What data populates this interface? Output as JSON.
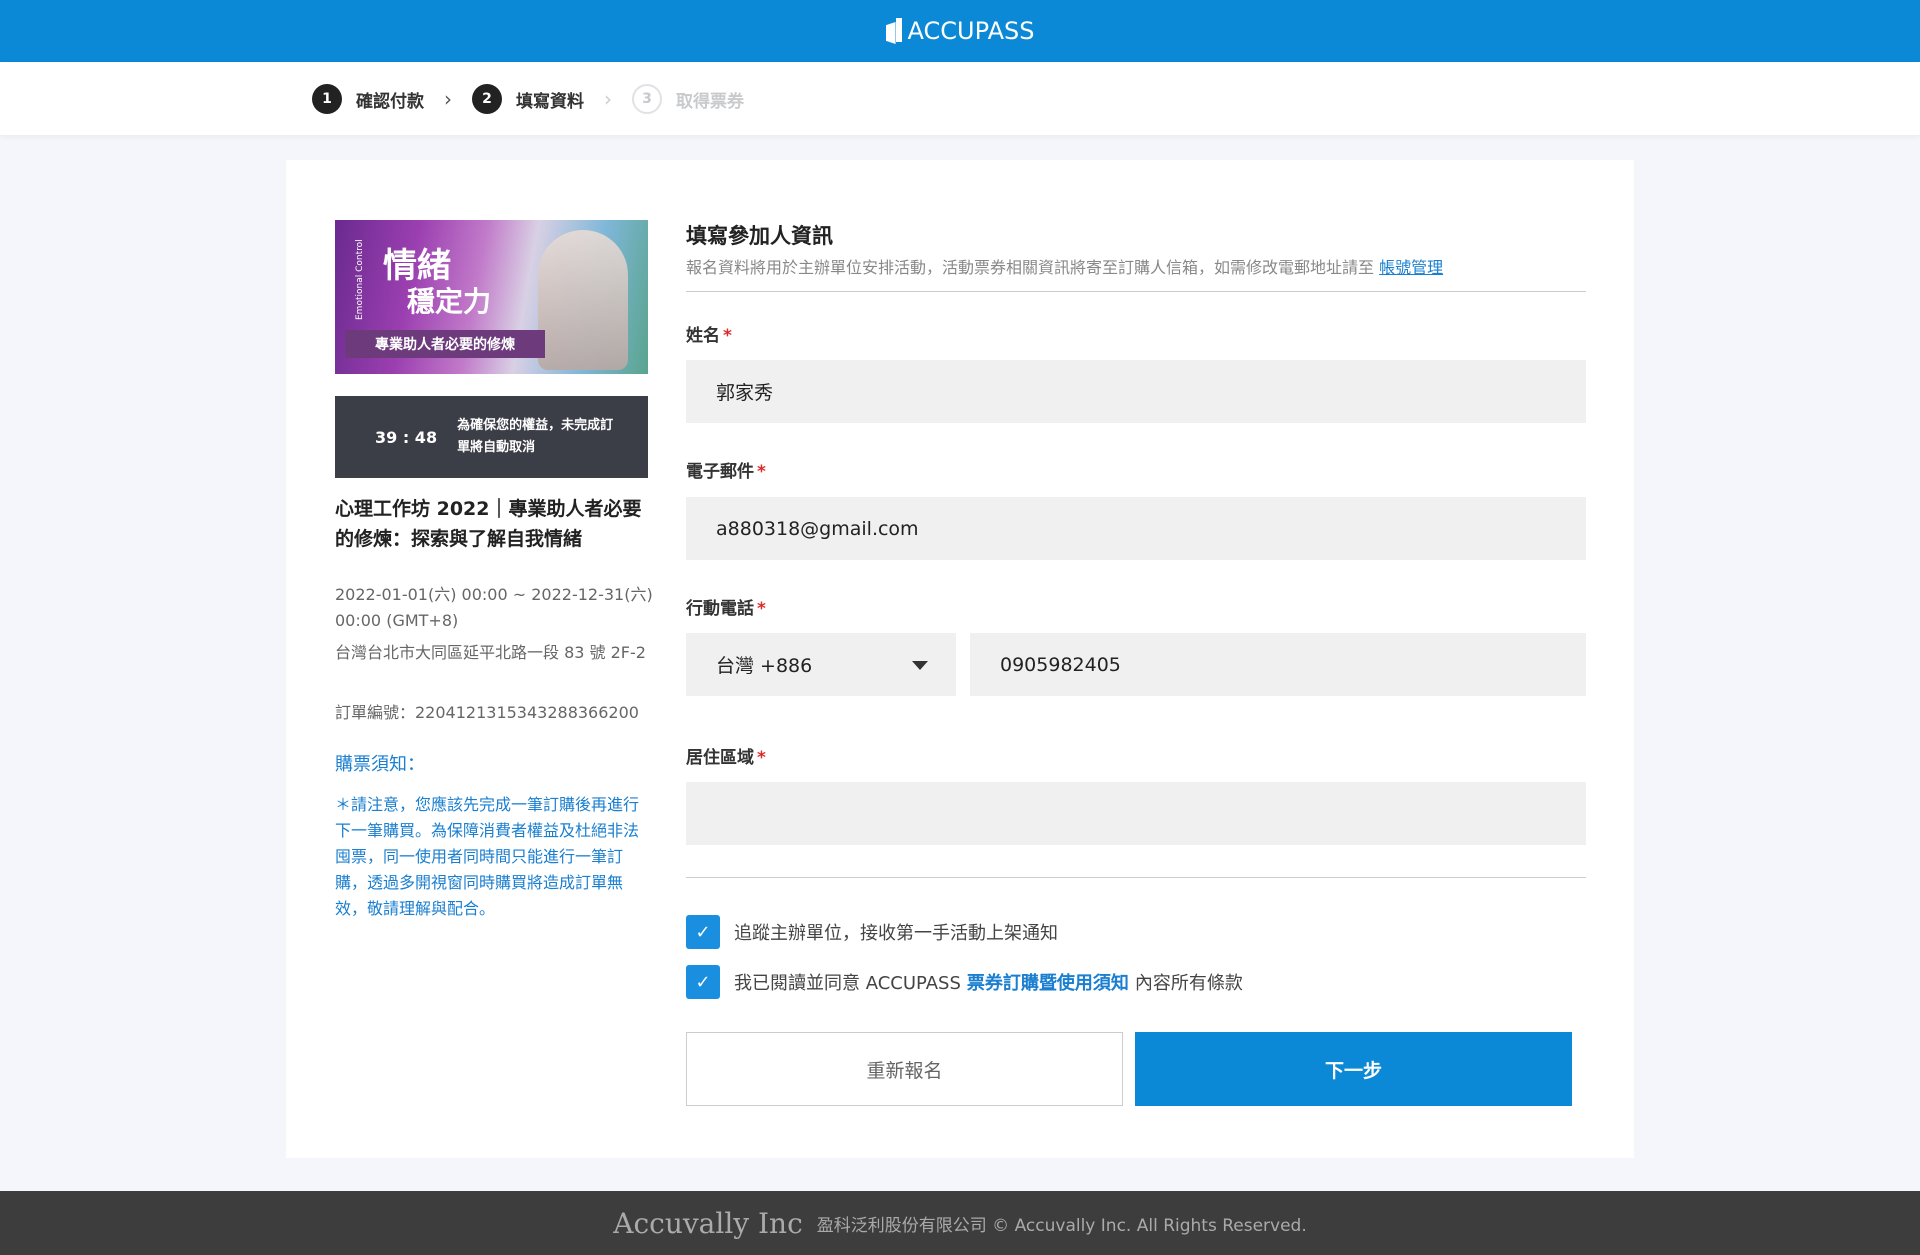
{
  "header": {
    "logo_text": "ACCUPASS"
  },
  "steps": [
    {
      "num": "1",
      "label": "確認付款"
    },
    {
      "num": "2",
      "label": "填寫資料"
    },
    {
      "num": "3",
      "label": "取得票券"
    }
  ],
  "event": {
    "banner": {
      "title_line1": "情緒",
      "title_line2": "穩定力",
      "subtitle": "專業助人者必要的修煉",
      "vertical_text": "Emotional Control"
    },
    "timer": {
      "clock": "39 : 48",
      "message": "為確保您的權益，未完成訂單將自動取消"
    },
    "title": "心理工作坊 2022｜專業助人者必要的修煉：探索與了解自我情緒",
    "datetime": "2022-01-01(六) 00:00 ~ 2022-12-31(六) 00:00 (GMT+8)",
    "address": "台灣台北市大同區延平北路一段 83 號 2F-2",
    "order_no": "訂單編號：2204121315343288366200",
    "notice_title": "購票須知：",
    "notice_body": "＊請注意，您應該先完成一筆訂購後再進行下一筆購買。為保障消費者權益及杜絕非法囤票，同一使用者同時間只能進行一筆訂購，透過多開視窗同時購買將造成訂單無效，敬請理解與配合。"
  },
  "form": {
    "title": "填寫參加人資訊",
    "desc": "報名資料將用於主辦單位安排活動，活動票券相關資訊將寄至訂購人信箱，如需修改電郵地址請至",
    "desc_link": "帳號管理",
    "name": {
      "label": "姓名",
      "value": "郭家秀"
    },
    "email": {
      "label": "電子郵件",
      "value": "a880318@gmail.com"
    },
    "phone": {
      "label": "行動電話",
      "country": "台灣 +886",
      "value": "0905982405"
    },
    "region": {
      "label": "居住區域",
      "value": ""
    },
    "required_mark": "*",
    "checkbox_follow": "追蹤主辦單位，接收第一手活動上架通知",
    "checkbox_agree_prefix": "我已閱讀並同意 ACCUPASS",
    "checkbox_agree_link": "票券訂購暨使用須知",
    "checkbox_agree_suffix": "內容所有條款",
    "check_glyph": "✓",
    "btn_reset": "重新報名",
    "btn_next": "下一步"
  },
  "footer": {
    "brand": "Accuvally Inc",
    "copyright": "盈科泛利股份有限公司 © Accuvally Inc. All Rights Reserved."
  },
  "colors": {
    "brand": "#0b88d6",
    "link": "#1a7fd0",
    "required": "#e02a2a",
    "footer": "#3d3d3d"
  },
  "icons": {
    "step_chevron": "chevron-right-icon",
    "dropdown": "caret-down-icon",
    "checkbox": "check-icon"
  }
}
